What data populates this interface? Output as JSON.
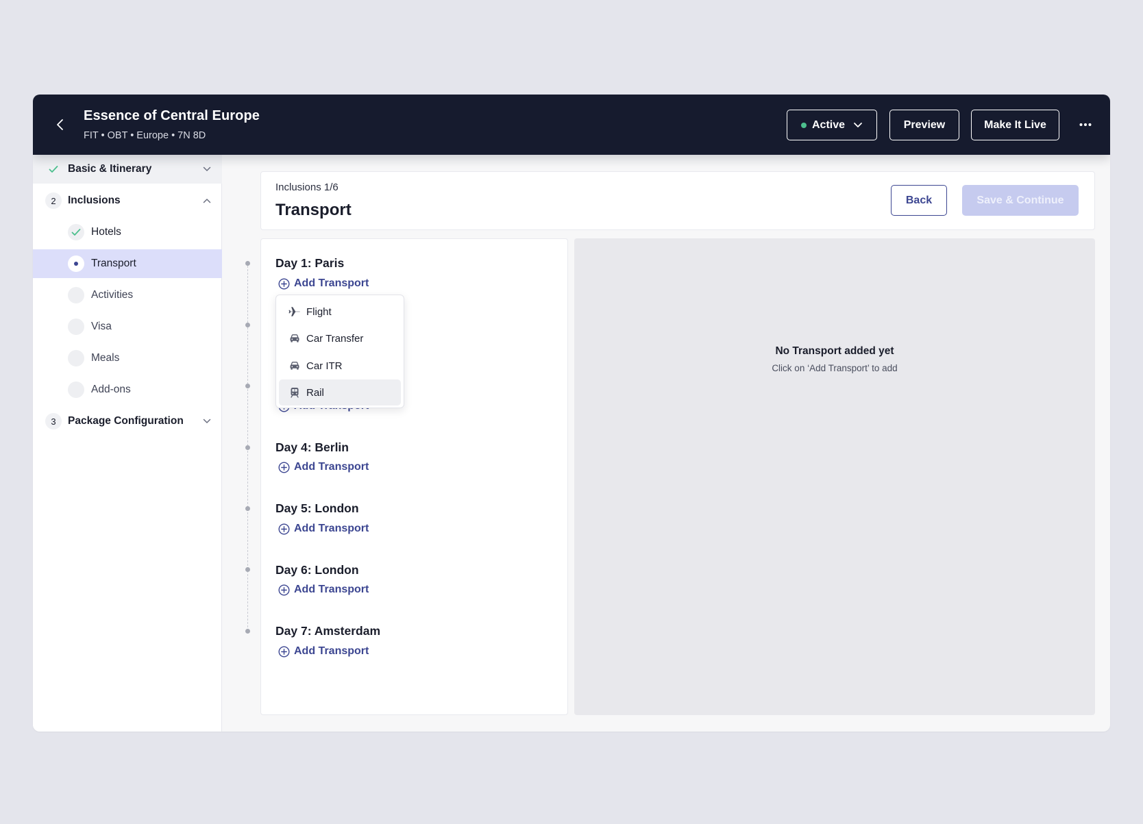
{
  "header": {
    "title": "Essence of Central Europe",
    "subtitle": "FIT • OBT • Europe • 7N 8D",
    "status_label": "Active",
    "status_color": "#4cbf8d",
    "preview_label": "Preview",
    "make_live_label": "Make It Live"
  },
  "sidebar": {
    "sections": [
      {
        "badge": "",
        "label": "Basic & Itinerary",
        "state": "complete"
      },
      {
        "badge": "2",
        "label": "Inclusions",
        "state": "expanded"
      },
      {
        "badge": "3",
        "label": "Package Configuration",
        "state": "collapsed"
      }
    ],
    "sub_items": [
      {
        "label": "Hotels",
        "state": "complete"
      },
      {
        "label": "Transport",
        "state": "current"
      },
      {
        "label": "Activities",
        "state": "pending"
      },
      {
        "label": "Visa",
        "state": "pending"
      },
      {
        "label": "Meals",
        "state": "pending"
      },
      {
        "label": "Add-ons",
        "state": "pending"
      }
    ]
  },
  "content": {
    "breadcrumb": "Inclusions 1/6",
    "title": "Transport",
    "back_label": "Back",
    "save_label": "Save & Continue"
  },
  "days": [
    {
      "title": "Day 1: Paris"
    },
    {
      "title": ""
    },
    {
      "title": ""
    },
    {
      "title": "Day 4: Berlin"
    },
    {
      "title": "Day 5: London"
    },
    {
      "title": "Day 6: London"
    },
    {
      "title": "Day 7: Amsterdam"
    }
  ],
  "add_transport_label": "Add Transport",
  "dropdown": {
    "items": [
      {
        "label": "Flight",
        "icon": "plane-icon"
      },
      {
        "label": "Car Transfer",
        "icon": "car-icon"
      },
      {
        "label": "Car ITR",
        "icon": "car-icon"
      },
      {
        "label": "Rail",
        "icon": "train-icon"
      }
    ],
    "highlighted": "Rail"
  },
  "empty_state": {
    "title": "No Transport added yet",
    "subtitle": "Click on ‘Add Transport’ to add"
  },
  "colors": {
    "header_bg": "#161b2e",
    "accent": "#3c4691",
    "check_green": "#4cbf8d",
    "selected_row": "#dcdefa",
    "save_disabled": "#c6cbef"
  }
}
